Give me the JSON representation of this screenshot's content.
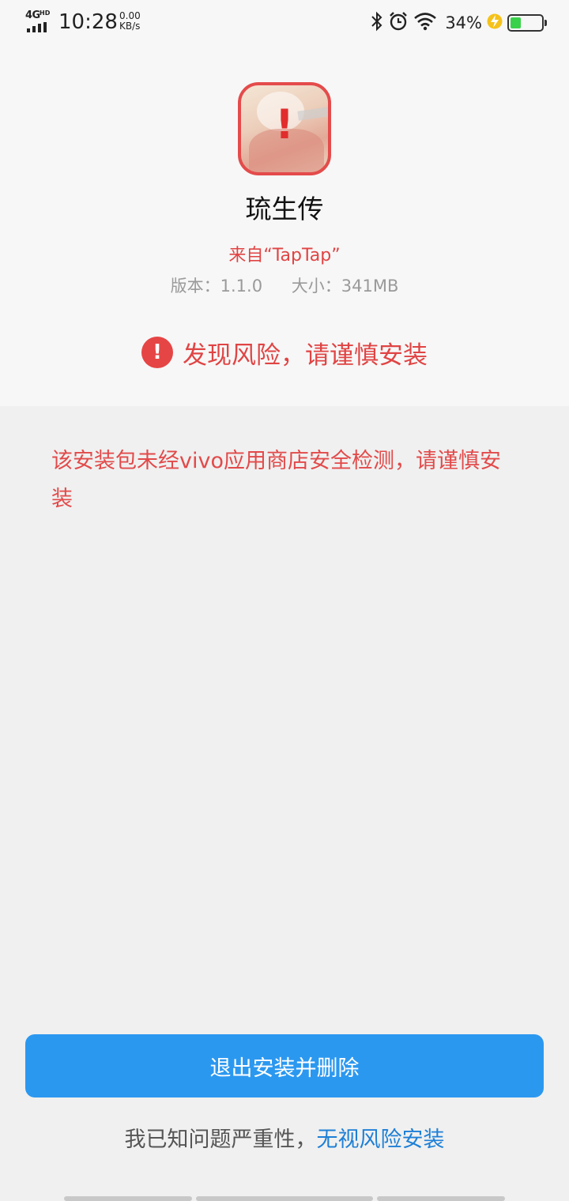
{
  "status_bar": {
    "network": "4G",
    "network_badge": "HD",
    "time": "10:28",
    "net_speed_value": "0.00",
    "net_speed_unit": "KB/s",
    "battery_percent": "34%",
    "battery_level": 0.34,
    "icons": [
      "bluetooth-icon",
      "alarm-icon",
      "wifi-icon",
      "charging-icon",
      "battery-icon"
    ]
  },
  "app": {
    "name": "琉生传",
    "source": "来自“TapTap”",
    "version": "版本：1.1.0",
    "size": "大小：341MB",
    "icon_alert": "!"
  },
  "risk": {
    "icon": "!",
    "title": "发现风险，请谨慎安装",
    "description": "该安装包未经vivo应用商店安全检测，请谨慎安装"
  },
  "actions": {
    "exit_delete": "退出安装并删除",
    "ignore_prefix": "我已知问题严重性，",
    "ignore_link": "无视风险安装"
  },
  "colors": {
    "warning_red": "#e04444",
    "primary_blue": "#2b98f0",
    "link_blue": "#1e7fd6"
  }
}
